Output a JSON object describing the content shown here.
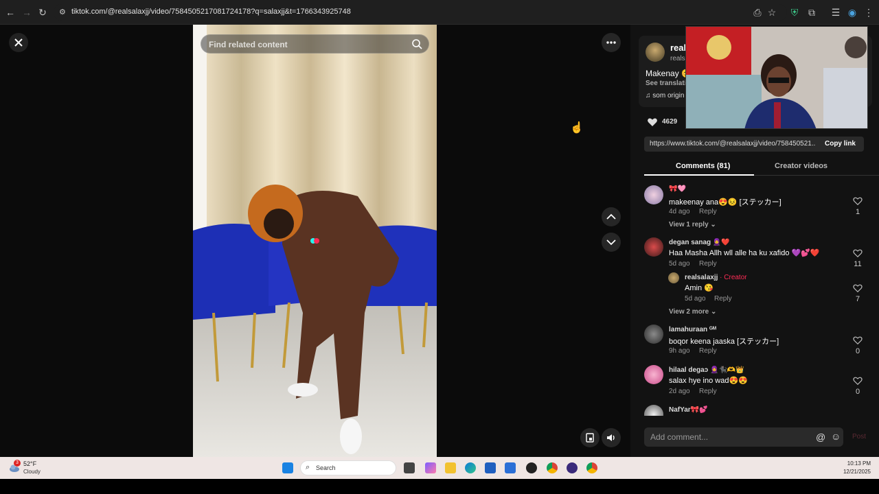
{
  "browser": {
    "url": "tiktok.com/@realsalaxjj/video/7584505217081724178?q=salaxjj&t=1766343925748"
  },
  "player": {
    "search_placeholder": "Find related content",
    "icons": [
      "close-icon",
      "more-icon",
      "chevron-up-icon",
      "chevron-down-icon",
      "pip-icon",
      "volume-icon"
    ]
  },
  "info": {
    "author_name": "real",
    "author_handle": "realsa",
    "description": "Makenay 😊",
    "see_translation": "See translati",
    "music": "♫ som origin",
    "like_count": "4629",
    "link": "https://www.tiktok.com/@realsalaxjj/video/758450521...",
    "copy_link": "Copy link"
  },
  "tabs": {
    "comments": "Comments (81)",
    "creator_videos": "Creator videos"
  },
  "comments": [
    {
      "name": "🎀🩷",
      "text": "makeenay ana😍😣 [ステッカー]",
      "time": "4d ago",
      "reply": "Reply",
      "likes": "1",
      "view_replies": "View 1 reply ⌄"
    },
    {
      "name": "degan sanag 🧕❤️",
      "text": "Haa Masha Allh wll alle ha ku xafido 💜💕❤️",
      "time": "5d ago",
      "reply": "Reply",
      "likes": "11",
      "view_replies": "View 2 more ⌄"
    },
    {
      "name": "lamahuraan ᴳᴹ",
      "text": "boqor keena jaaska [ステッカー]",
      "time": "9h ago",
      "reply": "Reply",
      "likes": "0"
    },
    {
      "name": "hilaal degaɔ 🧕🐈‍⬛🫶👑",
      "text": "salax hye ino wad😍😍",
      "time": "2d ago",
      "reply": "Reply",
      "likes": "0"
    },
    {
      "name": "NafYar🎀💕",
      "text": "",
      "time": "",
      "reply": "",
      "likes": ""
    }
  ],
  "reply": {
    "name": "realsalaxjj",
    "creator_tag": " · Creator",
    "text": "Amin 😘",
    "time": "5d ago",
    "reply": "Reply",
    "likes": "7"
  },
  "add_comment": {
    "placeholder": "Add comment...",
    "post": "Post"
  },
  "taskbar": {
    "badge": "3",
    "temp": "52°F",
    "weather": "Cloudy",
    "search": "Search",
    "time": "10:13 PM",
    "date": "12/21/2025"
  },
  "colors": {
    "accent": "#fe2c55",
    "panel": "#121212",
    "stage": "#0b0b0b"
  }
}
